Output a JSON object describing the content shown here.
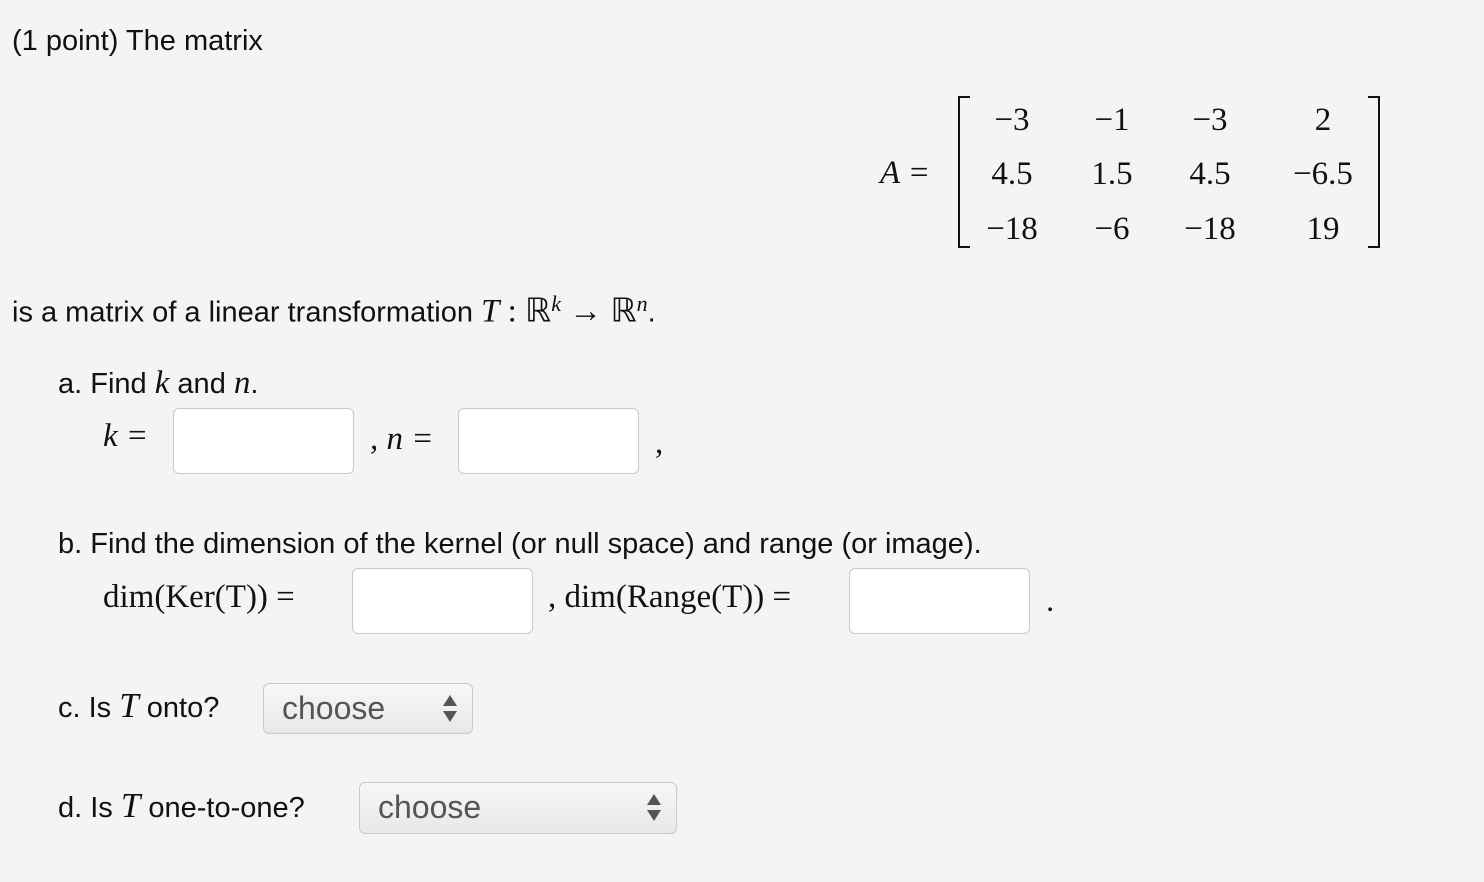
{
  "title": "(1 point) The matrix",
  "matrix": {
    "label": "A =",
    "rows": [
      [
        "−3",
        "−1",
        "−3",
        "2"
      ],
      [
        "4.5",
        "1.5",
        "4.5",
        "−6.5"
      ],
      [
        "−18",
        "−6",
        "−18",
        "19"
      ]
    ]
  },
  "statement": {
    "prefix": "is a matrix of a linear transformation ",
    "T": "T",
    "colon": " : ℝ",
    "k": "k",
    "arrow": " → ℝ",
    "n": "n",
    "end": "."
  },
  "part_a": {
    "label": "a. Find ",
    "k": "k",
    "and": " and ",
    "n": "n",
    "end": ".",
    "k_eq": "k =",
    "n_eq": ", n =",
    "trail": ",",
    "k_value": "",
    "n_value": ""
  },
  "part_b": {
    "label": "b. Find the dimension of the kernel (or null space) and range (or image).",
    "ker_eq": "dim(Ker(T)) =",
    "range_eq": ", dim(Range(T)) =",
    "end": ".",
    "ker_value": "",
    "range_value": ""
  },
  "part_c": {
    "label": "c. Is ",
    "T": "T",
    "rest": " onto?",
    "select": "choose"
  },
  "part_d": {
    "label": "d. Is ",
    "T": "T",
    "rest": " one-to-one?",
    "select": "choose"
  }
}
